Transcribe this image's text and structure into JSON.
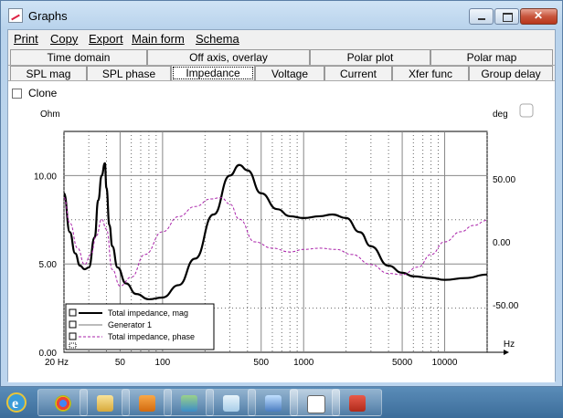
{
  "window": {
    "title": "Graphs"
  },
  "menu": [
    "Print",
    "Copy",
    "Export",
    "Main form",
    "Schema"
  ],
  "tabs_row1": [
    "Time domain",
    "Off axis, overlay",
    "Polar plot",
    "Polar map"
  ],
  "tabs_row2": [
    "SPL mag",
    "SPL phase",
    "Impedance",
    "Voltage",
    "Current",
    "Xfer func",
    "Group delay"
  ],
  "active_tab": "Impedance",
  "clone": {
    "label": "Clone",
    "checked": false
  },
  "chart_data": {
    "type": "line",
    "y_left_label": "Ohm",
    "y_right_label": "deg",
    "x_unit_label": "Hz",
    "x_scale": "log",
    "xlim": [
      20,
      20000
    ],
    "ylim_left": [
      0,
      12.5
    ],
    "ylim_right": [
      -87.5,
      87.5
    ],
    "x_ticks": [
      "20 Hz",
      "50",
      "100",
      "500",
      "1000",
      "5000",
      "10000"
    ],
    "y_left_ticks": [
      "0.00",
      "5.00",
      "10.00"
    ],
    "y_right_ticks": [
      "-50.00",
      "0.00",
      "50.00"
    ],
    "legend": [
      "Total impedance, mag",
      "Generator 1",
      "Total impedance, phase"
    ],
    "series": [
      {
        "name": "Total impedance, mag",
        "axis": "left",
        "color": "#000000",
        "x": [
          20,
          22,
          24,
          26,
          28,
          30,
          33,
          35,
          37,
          39,
          40,
          42,
          44,
          48,
          55,
          65,
          80,
          100,
          130,
          170,
          230,
          300,
          350,
          400,
          500,
          650,
          800,
          1000,
          1300,
          1600,
          2000,
          2500,
          3000,
          4000,
          5000,
          6000,
          8000,
          10000,
          14000,
          20000
        ],
        "y": [
          9.0,
          6.8,
          5.6,
          4.9,
          4.7,
          4.8,
          6.5,
          8.6,
          10.0,
          10.7,
          9.3,
          7.2,
          6.0,
          4.8,
          3.9,
          3.3,
          3.0,
          3.1,
          3.8,
          5.3,
          7.8,
          10.0,
          10.6,
          10.3,
          9.0,
          8.1,
          7.7,
          7.6,
          7.7,
          7.8,
          7.6,
          6.8,
          6.0,
          4.9,
          4.5,
          4.3,
          4.2,
          4.1,
          4.2,
          4.4
        ]
      },
      {
        "name": "Generator 1",
        "axis": "left",
        "color": "#777777",
        "x": [],
        "y": []
      },
      {
        "name": "Total impedance, phase",
        "axis": "right",
        "color": "#aa22aa",
        "x": [
          20,
          22,
          25,
          28,
          31,
          34,
          37,
          40,
          44,
          50,
          60,
          75,
          100,
          130,
          170,
          220,
          260,
          300,
          350,
          450,
          600,
          800,
          1000,
          1300,
          1700,
          2200,
          3000,
          4000,
          5000,
          6500,
          8000,
          10000,
          13000,
          16000,
          20000
        ],
        "y": [
          35,
          15,
          -5,
          -18,
          -10,
          5,
          18,
          10,
          -22,
          -35,
          -28,
          -10,
          8,
          20,
          28,
          34,
          35,
          30,
          18,
          0,
          -5,
          -8,
          -6,
          -5,
          -6,
          -10,
          -18,
          -25,
          -26,
          -20,
          -10,
          0,
          8,
          13,
          17
        ]
      }
    ]
  }
}
